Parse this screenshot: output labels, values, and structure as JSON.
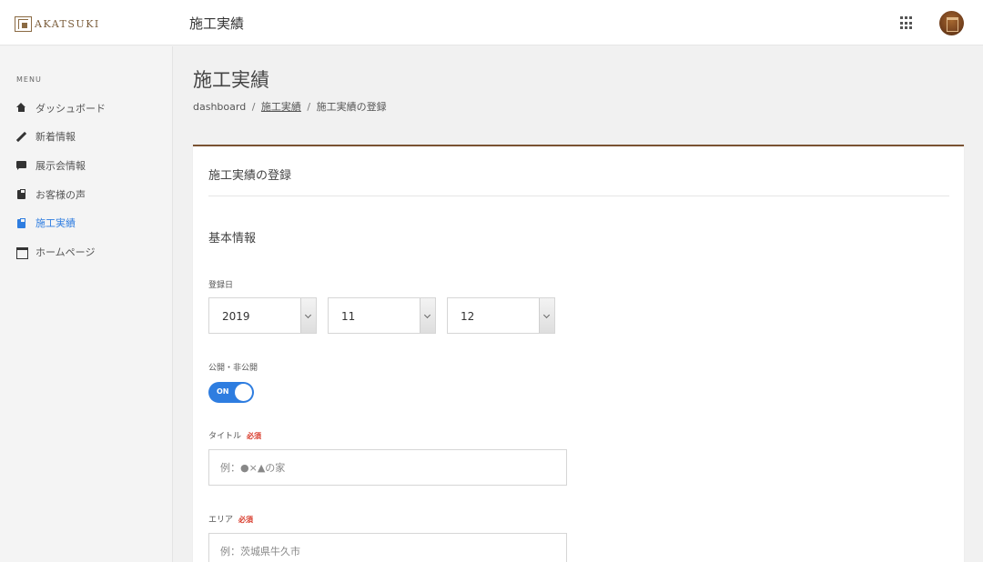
{
  "header": {
    "logo_text": "AKATSUKI",
    "title": "施工実績"
  },
  "sidebar": {
    "menu_heading": "MENU",
    "items": [
      {
        "label": "ダッシュボード",
        "icon": "home-icon"
      },
      {
        "label": "新着情報",
        "icon": "pencil-icon"
      },
      {
        "label": "展示会情報",
        "icon": "chat-icon"
      },
      {
        "label": "お客様の声",
        "icon": "clipboard-icon"
      },
      {
        "label": "施工実績",
        "icon": "clipboard-icon",
        "active": true
      },
      {
        "label": "ホームページ",
        "icon": "window-icon"
      }
    ]
  },
  "page": {
    "title": "施工実績",
    "breadcrumb": {
      "home": "dashboard",
      "section": "施工実績",
      "current": "施工実績の登録",
      "separator": "/"
    }
  },
  "card": {
    "title": "施工実績の登録",
    "section_title": "基本情報",
    "date_label": "登録日",
    "year": "2019",
    "month": "11",
    "day": "12",
    "visibility_label": "公開・非公開",
    "toggle_label": "ON",
    "toggle_on": true,
    "title_label": "タイトル",
    "title_placeholder": "例：●×▲の家",
    "area_label": "エリア",
    "area_placeholder": "例：茨城県牛久市",
    "required_label": "必須"
  },
  "colors": {
    "accent": "#2e7de0",
    "brand": "#7a5232",
    "required": "#d83a2a"
  }
}
